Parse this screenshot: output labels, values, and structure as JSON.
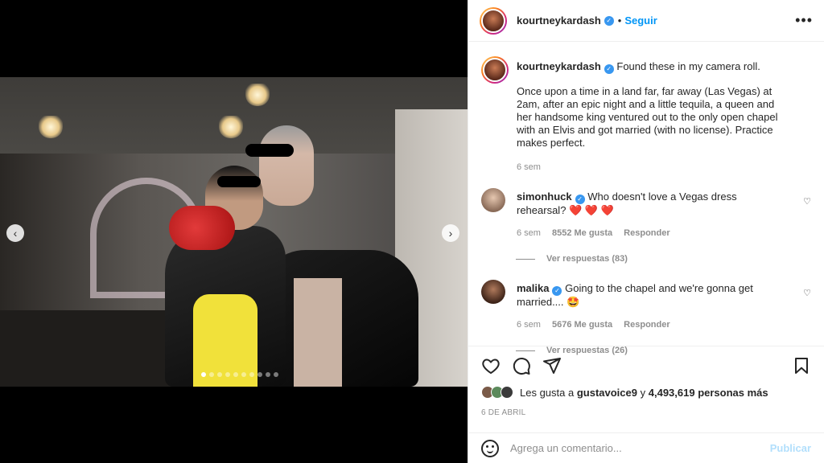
{
  "header": {
    "username": "kourtneykardash",
    "separator": "•",
    "follow_label": "Seguir",
    "more_label": "•••"
  },
  "caption": {
    "username": "kourtneykardash",
    "line1": "Found these in my camera roll.",
    "body": "Once upon a time in a land far, far away (Las Vegas) at 2am, after an epic night and a little tequila, a queen and her handsome king ventured out to the only open chapel with an Elvis and got married (with no license). Practice makes perfect.",
    "time": "6 sem"
  },
  "comments": [
    {
      "username": "simonhuck",
      "text": "Who doesn't love a Vegas dress rehearsal?",
      "emoji": "❤️ ❤️ ❤️",
      "time": "6 sem",
      "likes": "8552 Me gusta",
      "reply_label": "Responder",
      "replies_label": "Ver respuestas (83)"
    },
    {
      "username": "malika",
      "text": "Going to the chapel and we're gonna get married....",
      "emoji": "🤩",
      "time": "6 sem",
      "likes": "5676 Me gusta",
      "reply_label": "Responder",
      "replies_label": "Ver respuestas (26)"
    }
  ],
  "likes": {
    "prefix": "Les gusta a",
    "user": "gustavoice9",
    "connector": "y",
    "count": "4,493,619 personas más"
  },
  "date": "6 DE ABRIL",
  "add_comment": {
    "placeholder": "Agrega un comentario...",
    "publish_label": "Publicar"
  },
  "carousel": {
    "prev_label": "‹",
    "next_label": "›",
    "total": 10,
    "active": 1
  },
  "colors": {
    "accent": "#0095f6",
    "verified": "#3897f0",
    "heart": "#ed4956",
    "publish_disabled": "#b2dffc"
  }
}
